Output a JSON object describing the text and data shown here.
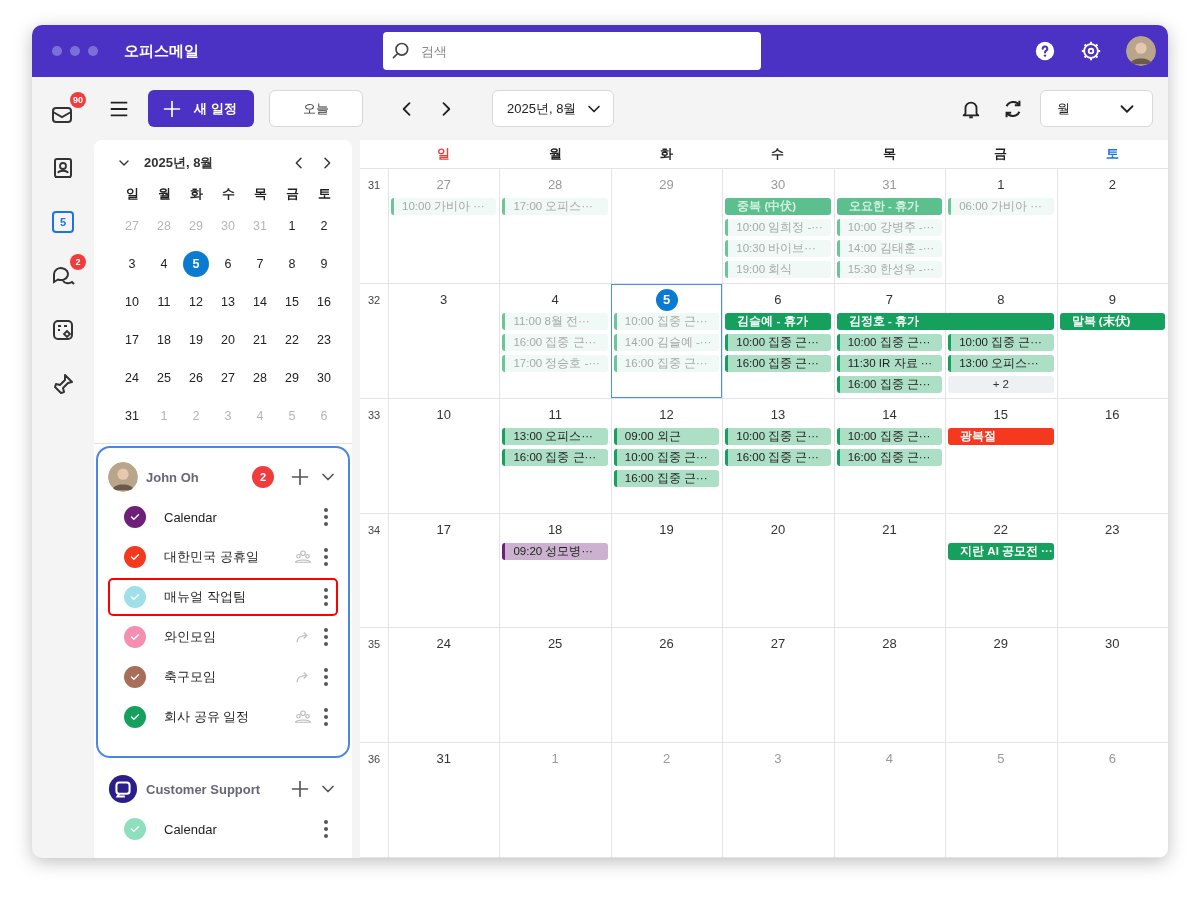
{
  "app": {
    "title": "오피스메일",
    "search": {
      "placeholder": "검색"
    }
  },
  "rail": [
    {
      "kind": "mail",
      "badge": "90",
      "selected": false
    },
    {
      "kind": "contacts",
      "selected": false
    },
    {
      "kind": "calendar",
      "label": "5",
      "selected": true
    },
    {
      "kind": "chat",
      "badge": "2",
      "selected": false
    },
    {
      "kind": "board",
      "selected": false
    },
    {
      "kind": "pin",
      "selected": false
    }
  ],
  "toolbar": {
    "new_button": "새 일정",
    "today_button": "오늘",
    "period": "2025년, 8월",
    "view": "월"
  },
  "mini_calendar": {
    "title": "2025년, 8월",
    "weekdays": [
      "일",
      "월",
      "화",
      "수",
      "목",
      "금",
      "토"
    ],
    "weeks": [
      [
        {
          "label": "27",
          "muted": true,
          "selected": false
        },
        {
          "label": "28",
          "muted": true,
          "selected": false
        },
        {
          "label": "29",
          "muted": true,
          "selected": false
        },
        {
          "label": "30",
          "muted": true,
          "selected": false
        },
        {
          "label": "31",
          "muted": true,
          "selected": false
        },
        {
          "label": "1",
          "muted": false,
          "selected": false
        },
        {
          "label": "2",
          "muted": false,
          "selected": false
        }
      ],
      [
        {
          "label": "3",
          "muted": false,
          "selected": false
        },
        {
          "label": "4",
          "muted": false,
          "selected": false
        },
        {
          "label": "5",
          "muted": false,
          "selected": true
        },
        {
          "label": "6",
          "muted": false,
          "selected": false
        },
        {
          "label": "7",
          "muted": false,
          "selected": false
        },
        {
          "label": "8",
          "muted": false,
          "selected": false
        },
        {
          "label": "9",
          "muted": false,
          "selected": false
        }
      ],
      [
        {
          "label": "10",
          "muted": false,
          "selected": false
        },
        {
          "label": "11",
          "muted": false,
          "selected": false
        },
        {
          "label": "12",
          "muted": false,
          "selected": false
        },
        {
          "label": "13",
          "muted": false,
          "selected": false
        },
        {
          "label": "14",
          "muted": false,
          "selected": false
        },
        {
          "label": "15",
          "muted": false,
          "selected": false
        },
        {
          "label": "16",
          "muted": false,
          "selected": false
        }
      ],
      [
        {
          "label": "17",
          "muted": false,
          "selected": false
        },
        {
          "label": "18",
          "muted": false,
          "selected": false
        },
        {
          "label": "19",
          "muted": false,
          "selected": false
        },
        {
          "label": "20",
          "muted": false,
          "selected": false
        },
        {
          "label": "21",
          "muted": false,
          "selected": false
        },
        {
          "label": "22",
          "muted": false,
          "selected": false
        },
        {
          "label": "23",
          "muted": false,
          "selected": false
        }
      ],
      [
        {
          "label": "24",
          "muted": false,
          "selected": false
        },
        {
          "label": "25",
          "muted": false,
          "selected": false
        },
        {
          "label": "26",
          "muted": false,
          "selected": false
        },
        {
          "label": "27",
          "muted": false,
          "selected": false
        },
        {
          "label": "28",
          "muted": false,
          "selected": false
        },
        {
          "label": "29",
          "muted": false,
          "selected": false
        },
        {
          "label": "30",
          "muted": false,
          "selected": false
        }
      ],
      [
        {
          "label": "31",
          "muted": false,
          "selected": false
        },
        {
          "label": "1",
          "muted": true,
          "selected": false
        },
        {
          "label": "2",
          "muted": true,
          "selected": false
        },
        {
          "label": "3",
          "muted": true,
          "selected": false
        },
        {
          "label": "4",
          "muted": true,
          "selected": false
        },
        {
          "label": "5",
          "muted": true,
          "selected": false
        },
        {
          "label": "6",
          "muted": true,
          "selected": false
        }
      ]
    ]
  },
  "accounts": [
    {
      "name": "John Oh",
      "badge": "2",
      "selected": true,
      "calendars": [
        {
          "kind": "own",
          "name": "Calendar",
          "color": "#6e1f78",
          "checked": true,
          "highlighted": false
        },
        {
          "kind": "shared",
          "name": "대한민국 공휴일",
          "color": "#f4391e",
          "checked": true,
          "highlighted": false
        },
        {
          "kind": "own",
          "name": "매뉴얼 작업팀",
          "color": "#9fe0e8",
          "checked": true,
          "highlighted": true
        },
        {
          "kind": "forwarded",
          "name": "와인모임",
          "color": "#f48fb1",
          "checked": true,
          "highlighted": false
        },
        {
          "kind": "forwarded",
          "name": "축구모임",
          "color": "#a86e5a",
          "checked": true,
          "highlighted": false
        },
        {
          "kind": "shared",
          "name": "회사 공유 일정",
          "color": "#16a05d",
          "checked": true,
          "highlighted": false
        }
      ]
    },
    {
      "name": "Customer Support",
      "selected": false,
      "calendars": [
        {
          "kind": "own",
          "name": "Calendar",
          "color": "#8ee0bd",
          "checked": true,
          "highlighted": false
        }
      ]
    }
  ],
  "month": {
    "weekdays": [
      {
        "label": "일",
        "color": "#f03c3c"
      },
      {
        "label": "월",
        "color": "#222222"
      },
      {
        "label": "화",
        "color": "#222222"
      },
      {
        "label": "수",
        "color": "#222222"
      },
      {
        "label": "목",
        "color": "#222222"
      },
      {
        "label": "금",
        "color": "#222222"
      },
      {
        "label": "토",
        "color": "#1a73e8"
      }
    ],
    "weeks": [
      {
        "number": "31",
        "days": [
          {
            "label": "27",
            "muted": true,
            "selected": false,
            "events": [
              {
                "kind": "timed",
                "text": "10:00 가비아 ···",
                "color": "#6cc59a",
                "past": true
              }
            ]
          },
          {
            "label": "28",
            "muted": true,
            "selected": false,
            "events": [
              {
                "kind": "timed",
                "text": "17:00 오피스···",
                "color": "#6cc59a",
                "past": true
              }
            ]
          },
          {
            "label": "29",
            "muted": true,
            "selected": false
          },
          {
            "label": "30",
            "muted": true,
            "selected": false,
            "events": [
              {
                "kind": "allday",
                "text": "중복 (中伏)",
                "color": "#5cbf8e",
                "past": true
              },
              {
                "kind": "timed",
                "text": "10:00 임희정 -···",
                "color": "#6cc59a",
                "past": true
              },
              {
                "kind": "timed",
                "text": "10:30 바이브···",
                "color": "#6cc59a",
                "past": true
              },
              {
                "kind": "timed",
                "text": "19:00 회식",
                "color": "#6cc59a",
                "past": true
              }
            ]
          },
          {
            "label": "31",
            "muted": true,
            "selected": false,
            "events": [
              {
                "kind": "allday",
                "text": "오요한 - 휴가",
                "color": "#5cbf8e",
                "past": true
              },
              {
                "kind": "timed",
                "text": "10:00 강병주 -···",
                "color": "#6cc59a",
                "past": true
              },
              {
                "kind": "timed",
                "text": "14:00 김태훈 -···",
                "color": "#6cc59a",
                "past": true
              },
              {
                "kind": "timed",
                "text": "15:30 한성우 -···",
                "color": "#6cc59a",
                "past": true
              }
            ]
          },
          {
            "label": "1",
            "muted": false,
            "selected": false,
            "events": [
              {
                "kind": "timed",
                "text": "06:00 가비아 ···",
                "color": "#6cc59a",
                "past": true
              }
            ]
          },
          {
            "label": "2",
            "muted": false,
            "selected": false
          }
        ]
      },
      {
        "number": "32",
        "days": [
          {
            "label": "3",
            "muted": false,
            "selected": false
          },
          {
            "label": "4",
            "muted": false,
            "selected": false,
            "events": [
              {
                "kind": "timed",
                "text": "11:00 8월 전···",
                "color": "#6cc59a",
                "past": true
              },
              {
                "kind": "timed",
                "text": "16:00 집중 근···",
                "color": "#6cc59a",
                "past": true
              },
              {
                "kind": "timed",
                "text": "17:00 정승호 -···",
                "color": "#6cc59a",
                "past": true
              }
            ]
          },
          {
            "label": "5",
            "muted": false,
            "selected": true,
            "events": [
              {
                "kind": "timed",
                "text": "10:00 집중 근···",
                "color": "#6cc59a",
                "past": true
              },
              {
                "kind": "timed",
                "text": "14:00 김슬예 -···",
                "color": "#6cc59a",
                "past": true
              },
              {
                "kind": "timed",
                "text": "16:00 집중 근···",
                "color": "#6cc59a",
                "past": true
              }
            ]
          },
          {
            "label": "6",
            "muted": false,
            "selected": false,
            "events": [
              {
                "kind": "allday",
                "text": "김슬예 - 휴가",
                "color": "#16a05d",
                "past": false
              },
              {
                "kind": "timed",
                "text": "10:00 집중 근···",
                "color": "#16a05d",
                "past": false
              },
              {
                "kind": "timed",
                "text": "16:00 집중 근···",
                "color": "#16a05d",
                "past": false
              }
            ]
          },
          {
            "label": "7",
            "muted": false,
            "selected": false,
            "events": [
              {
                "kind": "allday",
                "text": "김정호 - 휴가",
                "color": "#16a05d",
                "past": false,
                "continues": true
              },
              {
                "kind": "timed",
                "text": "10:00 집중 근···",
                "color": "#16a05d",
                "past": false
              },
              {
                "kind": "timed",
                "text": "11:30 IR 자료 ···",
                "color": "#16a05d",
                "past": false
              },
              {
                "kind": "timed",
                "text": "16:00 집중 근···",
                "color": "#16a05d",
                "past": false
              }
            ]
          },
          {
            "label": "8",
            "muted": false,
            "selected": false,
            "events": [
              {
                "kind": "timed",
                "text": "10:00 집중 근···",
                "color": "#16a05d",
                "past": false
              },
              {
                "kind": "timed",
                "text": "13:00 오피스···",
                "color": "#16a05d",
                "past": false
              },
              {
                "kind": "more",
                "text": "+ 2"
              }
            ]
          },
          {
            "label": "9",
            "muted": false,
            "selected": false,
            "events": [
              {
                "kind": "allday",
                "text": "말복 (末伏)",
                "color": "#16a05d",
                "past": false
              }
            ]
          }
        ]
      },
      {
        "number": "33",
        "days": [
          {
            "label": "10",
            "muted": false,
            "selected": false
          },
          {
            "label": "11",
            "muted": false,
            "selected": false,
            "events": [
              {
                "kind": "timed",
                "text": "13:00 오피스···",
                "color": "#16a05d",
                "past": false
              },
              {
                "kind": "timed",
                "text": "16:00 집중 근···",
                "color": "#16a05d",
                "past": false
              }
            ]
          },
          {
            "label": "12",
            "muted": false,
            "selected": false,
            "events": [
              {
                "kind": "timed",
                "text": "09:00 외근",
                "color": "#16a05d",
                "past": false
              },
              {
                "kind": "timed",
                "text": "10:00 집중 근···",
                "color": "#16a05d",
                "past": false
              },
              {
                "kind": "timed",
                "text": "16:00 집중 근···",
                "color": "#16a05d",
                "past": false
              }
            ]
          },
          {
            "label": "13",
            "muted": false,
            "selected": false,
            "events": [
              {
                "kind": "timed",
                "text": "10:00 집중 근···",
                "color": "#16a05d",
                "past": false
              },
              {
                "kind": "timed",
                "text": "16:00 집중 근···",
                "color": "#16a05d",
                "past": false
              }
            ]
          },
          {
            "label": "14",
            "muted": false,
            "selected": false,
            "events": [
              {
                "kind": "timed",
                "text": "10:00 집중 근···",
                "color": "#16a05d",
                "past": false
              },
              {
                "kind": "timed",
                "text": "16:00 집중 근···",
                "color": "#16a05d",
                "past": false
              }
            ]
          },
          {
            "label": "15",
            "muted": false,
            "selected": false,
            "events": [
              {
                "kind": "allday",
                "text": "광복절",
                "color": "#f4391e",
                "past": false
              }
            ]
          },
          {
            "label": "16",
            "muted": false,
            "selected": false
          }
        ]
      },
      {
        "number": "34",
        "days": [
          {
            "label": "17",
            "muted": false,
            "selected": false
          },
          {
            "label": "18",
            "muted": false,
            "selected": false,
            "events": [
              {
                "kind": "timed",
                "text": "09:20 성모병···",
                "color": "#6e1f78",
                "past": false
              }
            ]
          },
          {
            "label": "19",
            "muted": false,
            "selected": false
          },
          {
            "label": "20",
            "muted": false,
            "selected": false
          },
          {
            "label": "21",
            "muted": false,
            "selected": false
          },
          {
            "label": "22",
            "muted": false,
            "selected": false,
            "events": [
              {
                "kind": "allday",
                "text": "지란 AI 공모전 ···",
                "color": "#16a05d",
                "past": false
              }
            ]
          },
          {
            "label": "23",
            "muted": false,
            "selected": false
          }
        ]
      },
      {
        "number": "35",
        "days": [
          {
            "label": "24",
            "muted": false,
            "selected": false
          },
          {
            "label": "25",
            "muted": false,
            "selected": false
          },
          {
            "label": "26",
            "muted": false,
            "selected": false
          },
          {
            "label": "27",
            "muted": false,
            "selected": false
          },
          {
            "label": "28",
            "muted": false,
            "selected": false
          },
          {
            "label": "29",
            "muted": false,
            "selected": false
          },
          {
            "label": "30",
            "muted": false,
            "selected": false
          }
        ]
      },
      {
        "number": "36",
        "days": [
          {
            "label": "31",
            "muted": false,
            "selected": false
          },
          {
            "label": "1",
            "muted": true,
            "selected": false
          },
          {
            "label": "2",
            "muted": true,
            "selected": false
          },
          {
            "label": "3",
            "muted": true,
            "selected": false
          },
          {
            "label": "4",
            "muted": true,
            "selected": false
          },
          {
            "label": "5",
            "muted": true,
            "selected": false
          },
          {
            "label": "6",
            "muted": true,
            "selected": false
          }
        ]
      }
    ]
  }
}
